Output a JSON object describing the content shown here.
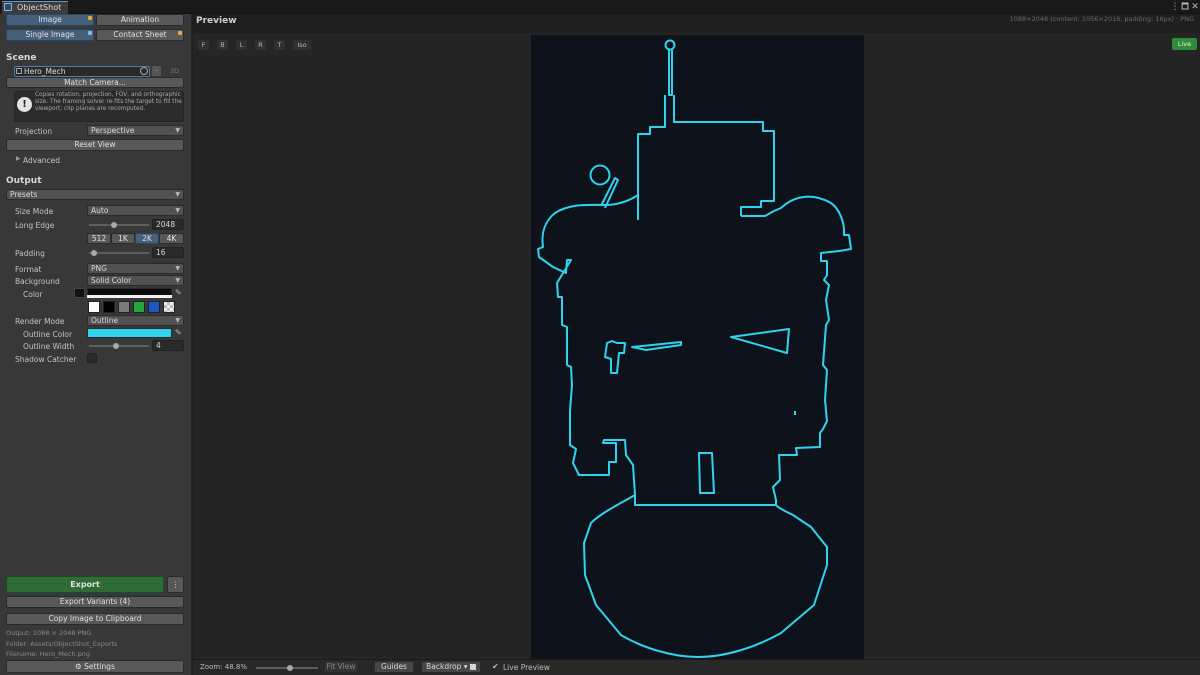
{
  "window": {
    "tab_title": "ObjectShot",
    "controls": [
      "⋮",
      "🗖",
      "✕"
    ]
  },
  "mode_tabs": {
    "image": "Image",
    "animation": "Animation",
    "single_image": "Single Image",
    "contact_sheet": "Contact Sheet"
  },
  "scene": {
    "header": "Scene",
    "target_value": "Hero_Mech",
    "dim_label": "3D",
    "match_camera": "Match Camera...",
    "help_text": "Copies rotation, projection, FOV, and orthographic size. The framing solver re-fits the target to fill the viewport; clip planes are recomputed.",
    "projection_label": "Projection",
    "projection_value": "Perspective",
    "reset_view": "Reset View",
    "advanced": "Advanced"
  },
  "output": {
    "header": "Output",
    "presets": "Presets",
    "size_mode_label": "Size Mode",
    "size_mode_value": "Auto",
    "long_edge_label": "Long Edge",
    "long_edge_value": "2048",
    "long_edge_fraction": 0.42,
    "size_buttons": [
      "512",
      "1K",
      "2K",
      "4K"
    ],
    "padding_label": "Padding",
    "padding_value": "16",
    "padding_fraction": 0.08,
    "format_label": "Format",
    "format_value": "PNG",
    "background_label": "Background",
    "background_value": "Solid Color",
    "color_label": "Color",
    "render_mode_label": "Render Mode",
    "render_mode_value": "Outline",
    "outline_color_label": "Outline Color",
    "outline_color": "#2fd3ee",
    "outline_width_label": "Outline Width",
    "outline_width_value": "4",
    "outline_width_fraction": 0.45,
    "shadow_catcher_label": "Shadow Catcher"
  },
  "actions": {
    "export": "Export",
    "more": "⋮",
    "export_variants": "Export Variants (4)",
    "copy_clipboard": "Copy Image to Clipboard",
    "output_info": "Output: 1088 × 2048 PNG",
    "folder_info": "Folder: Assets/ObjectShot_Exports",
    "filename_info": "Filename: Hero_Mech.png",
    "settings": "Settings"
  },
  "preview": {
    "title": "Preview",
    "dims_info": "1088×2048 (content: 1056×2016, padding: 16px) · PNG",
    "view_buttons": [
      "F",
      "B",
      "L",
      "R",
      "T",
      "Iso"
    ],
    "live_badge": "Live"
  },
  "bottom": {
    "zoom": "Zoom: 48.8%",
    "zoom_fraction": 0.55,
    "fit_view": "Fit View",
    "guides": "Guides",
    "backdrop": "Backdrop ▾",
    "live_preview": "Live Preview"
  },
  "colors": {
    "accent_blue": "#46607c",
    "export_green": "#2e6b35",
    "live_green": "#2f8a3a",
    "badge_orange": "#e8a83a",
    "outline_cyan": "#2fd3ee",
    "canvas_bg": "#0e121a"
  }
}
